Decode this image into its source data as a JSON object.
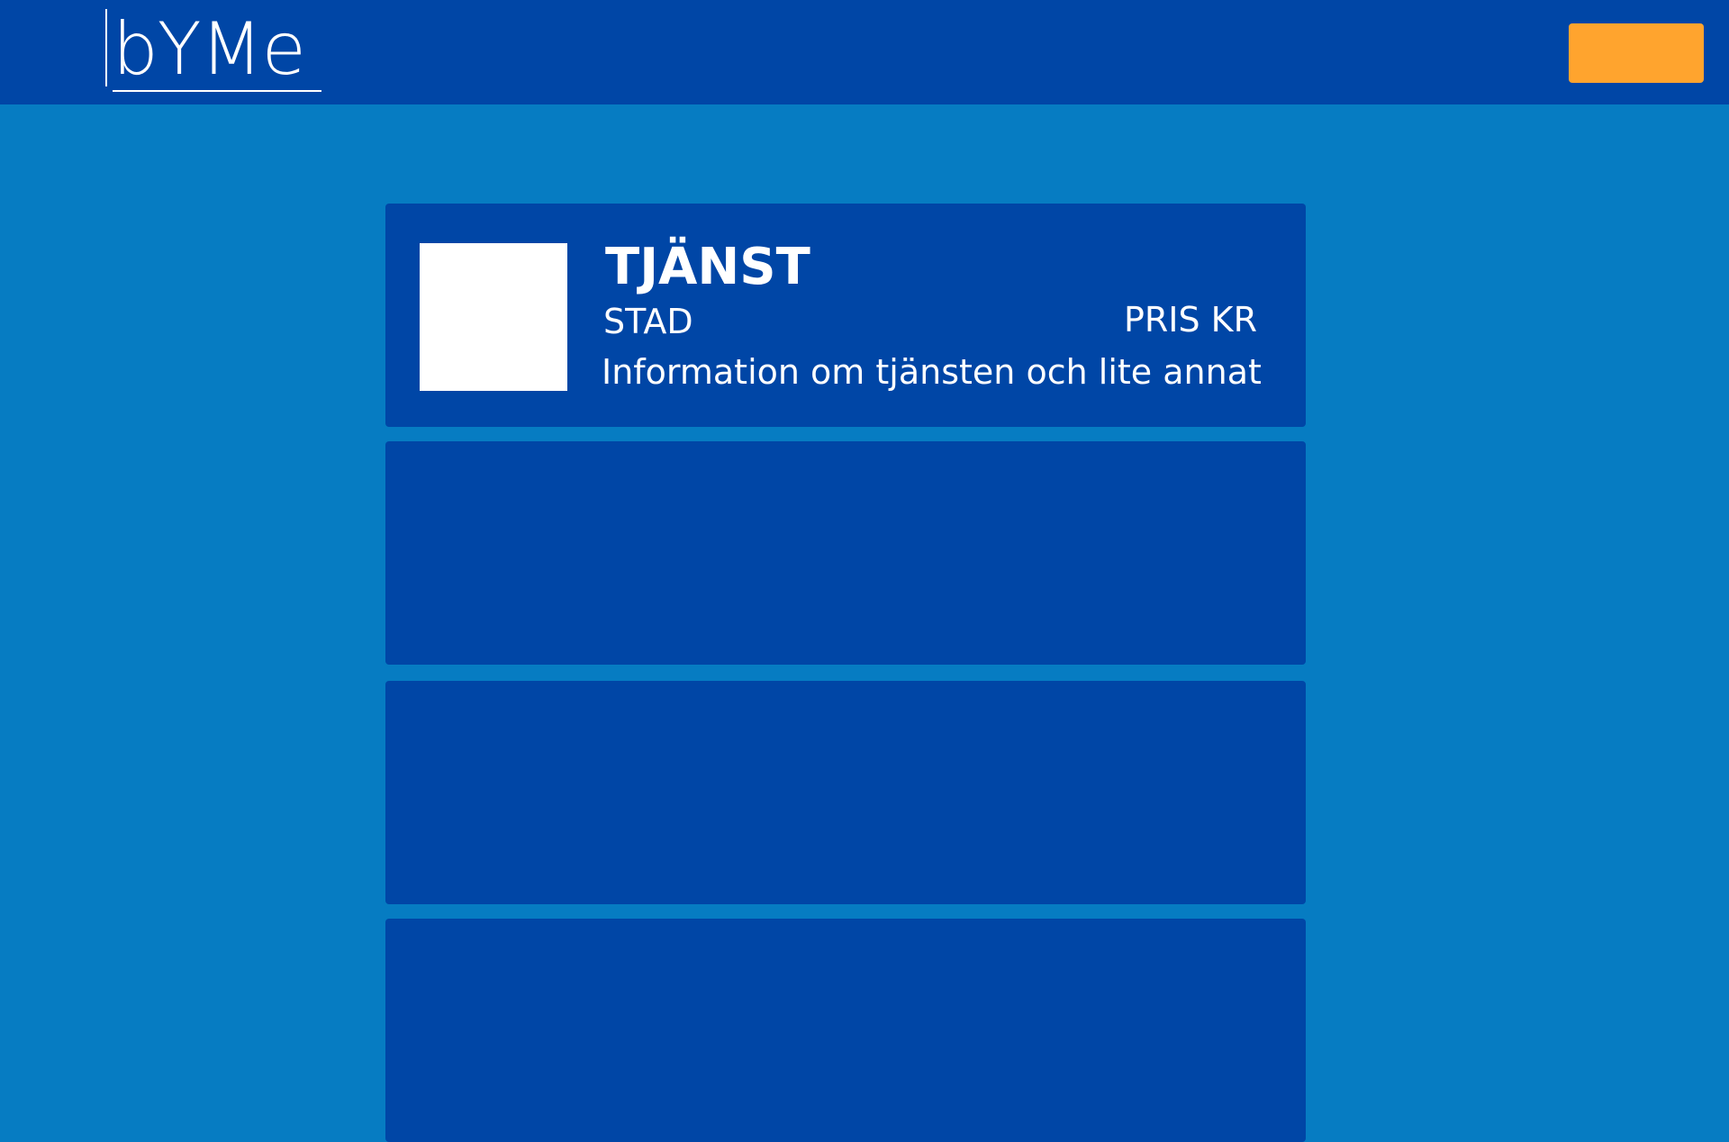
{
  "header": {
    "logo_text": "bYMe",
    "background_color": "#0046A6",
    "action_button_color": "#FFA42E",
    "action_button_label": ""
  },
  "page": {
    "background_color": "#067CC2"
  },
  "services": [
    {
      "title": "TJÄNST",
      "city": "STAD",
      "price": "PRIS KR",
      "description": "Information om tjänsten och lite annat so...",
      "thumbnail_color": "#FFFFFF"
    },
    {},
    {},
    {}
  ]
}
